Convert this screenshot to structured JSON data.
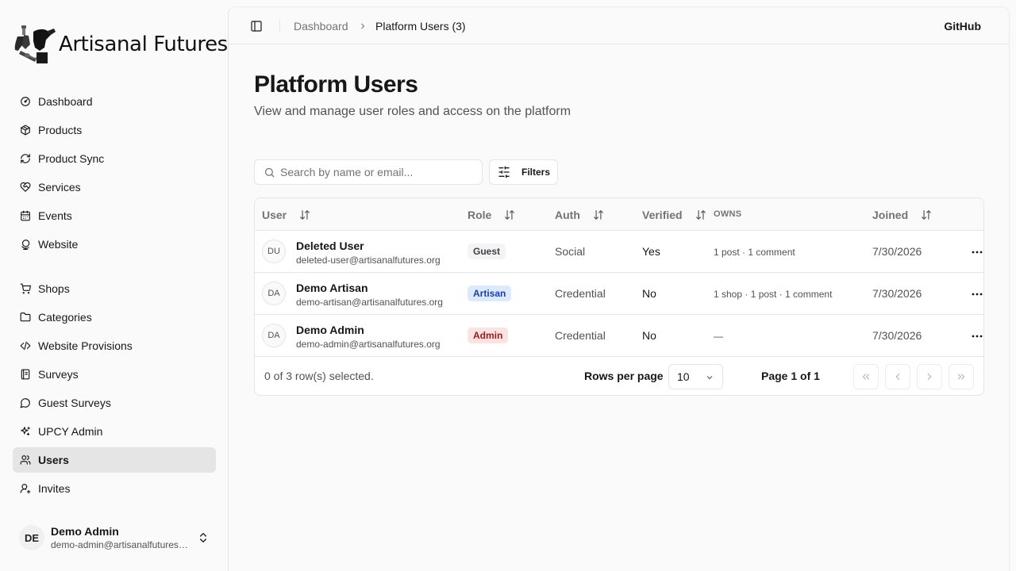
{
  "sidebar": {
    "brand": "Artisanal Futures",
    "nav_primary": [
      {
        "label": "Dashboard",
        "icon": "gauge-icon"
      },
      {
        "label": "Products",
        "icon": "package-icon"
      },
      {
        "label": "Product Sync",
        "icon": "refresh-icon"
      },
      {
        "label": "Services",
        "icon": "heart-handshake-icon"
      },
      {
        "label": "Events",
        "icon": "calendar-icon"
      },
      {
        "label": "Website",
        "icon": "globe-icon"
      }
    ],
    "nav_secondary": [
      {
        "label": "Shops",
        "icon": "shopping-cart-icon"
      },
      {
        "label": "Categories",
        "icon": "folder-icon"
      },
      {
        "label": "Website Provisions",
        "icon": "code-icon"
      },
      {
        "label": "Surveys",
        "icon": "notebook-icon"
      },
      {
        "label": "Guest Surveys",
        "icon": "message-circle-icon"
      },
      {
        "label": "UPCY Admin",
        "icon": "sparkles-icon"
      },
      {
        "label": "Users",
        "icon": "users-icon",
        "active": true
      },
      {
        "label": "Invites",
        "icon": "user-plus-icon"
      }
    ],
    "user": {
      "initials": "DE",
      "name": "Demo Admin",
      "email": "demo-admin@artisanalfutures.org"
    }
  },
  "topbar": {
    "breadcrumb": [
      "Dashboard",
      "Platform Users (3)"
    ],
    "github": "GitHub"
  },
  "page": {
    "title": "Platform Users",
    "subtitle": "View and manage user roles and access on the platform"
  },
  "toolbar": {
    "search_placeholder": "Search by name or email...",
    "filters_label": "Filters"
  },
  "table": {
    "columns": {
      "user": "User",
      "role": "Role",
      "auth": "Auth",
      "verified": "Verified",
      "owns": "OWNS",
      "joined": "Joined"
    },
    "rows": [
      {
        "initials": "DU",
        "name": "Deleted User",
        "email": "deleted-user@artisanalfutures.org",
        "role": "Guest",
        "auth": "Social",
        "verified": "Yes",
        "owns": "1 post · 1 comment",
        "joined": "7/30/2026"
      },
      {
        "initials": "DA",
        "name": "Demo Artisan",
        "email": "demo-artisan@artisanalfutures.org",
        "role": "Artisan",
        "auth": "Credential",
        "verified": "No",
        "owns": "1 shop · 1 post · 1 comment",
        "joined": "7/30/2026"
      },
      {
        "initials": "DA",
        "name": "Demo Admin",
        "email": "demo-admin@artisanalfutures.org",
        "role": "Admin",
        "auth": "Credential",
        "verified": "No",
        "owns": "—",
        "joined": "7/30/2026"
      }
    ],
    "role_colors": {
      "Guest": {
        "bg": "#f4f4f5",
        "fg": "#3f3f46"
      },
      "Artisan": {
        "bg": "#dbeafe",
        "fg": "#1e40af"
      },
      "Admin": {
        "bg": "#fee2e2",
        "fg": "#991b1b"
      }
    },
    "footer": {
      "selection": "0 of 3 row(s) selected.",
      "rows_per_page_label": "Rows per page",
      "rows_per_page_value": "10",
      "page_info": "Page 1 of 1"
    }
  }
}
